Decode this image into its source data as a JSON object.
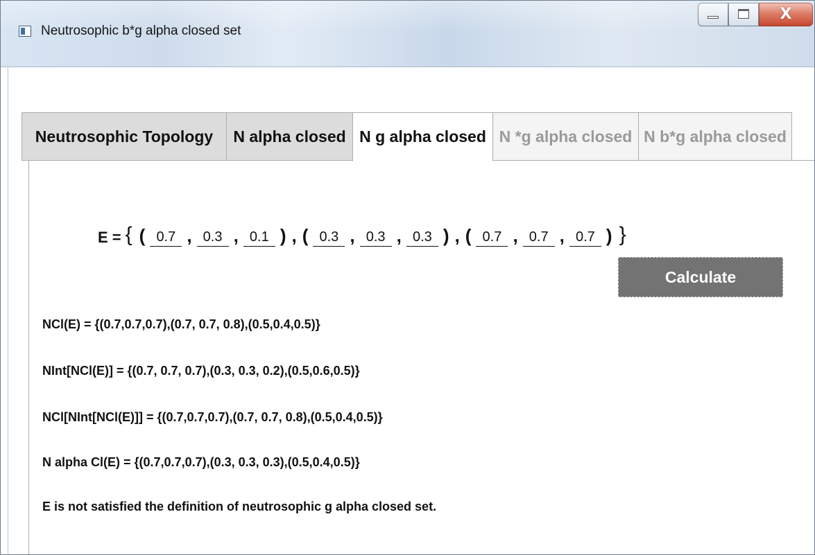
{
  "window": {
    "title": "Neutrosophic b*g alpha closed set",
    "close_glyph": "X"
  },
  "tabs": [
    {
      "label": "Neutrosophic Topology",
      "state": "normal"
    },
    {
      "label": "N alpha closed",
      "state": "normal"
    },
    {
      "label": "N g alpha closed",
      "state": "active"
    },
    {
      "label": "N *g alpha closed",
      "state": "disabled"
    },
    {
      "label": "N b*g alpha closed",
      "state": "disabled"
    }
  ],
  "set_input": {
    "prefix": "E =",
    "open_brace": "{",
    "close_brace": "}",
    "triples": [
      [
        "0.7",
        "0.3",
        "0.1"
      ],
      [
        "0.3",
        "0.3",
        "0.3"
      ],
      [
        "0.7",
        "0.7",
        "0.7"
      ]
    ]
  },
  "calculate_label": "Calculate",
  "results": [
    "NCl(E) = {(0.7,0.7,0.7),(0.7, 0.7, 0.8),(0.5,0.4,0.5)}",
    "NInt[NCl(E)] = {(0.7, 0.7, 0.7),(0.3, 0.3, 0.2),(0.5,0.6,0.5)}",
    "NCl[NInt[NCl(E)]] = {(0.7,0.7,0.7),(0.7, 0.7, 0.8),(0.5,0.4,0.5)}",
    "N alpha Cl(E) = {(0.7,0.7,0.7),(0.3, 0.3, 0.3),(0.5,0.4,0.5)}",
    "E is not satisfied the definition of neutrosophic g alpha closed set."
  ],
  "colors": {
    "calculate_bg": "#737373",
    "close_button": "#c23b1f"
  }
}
